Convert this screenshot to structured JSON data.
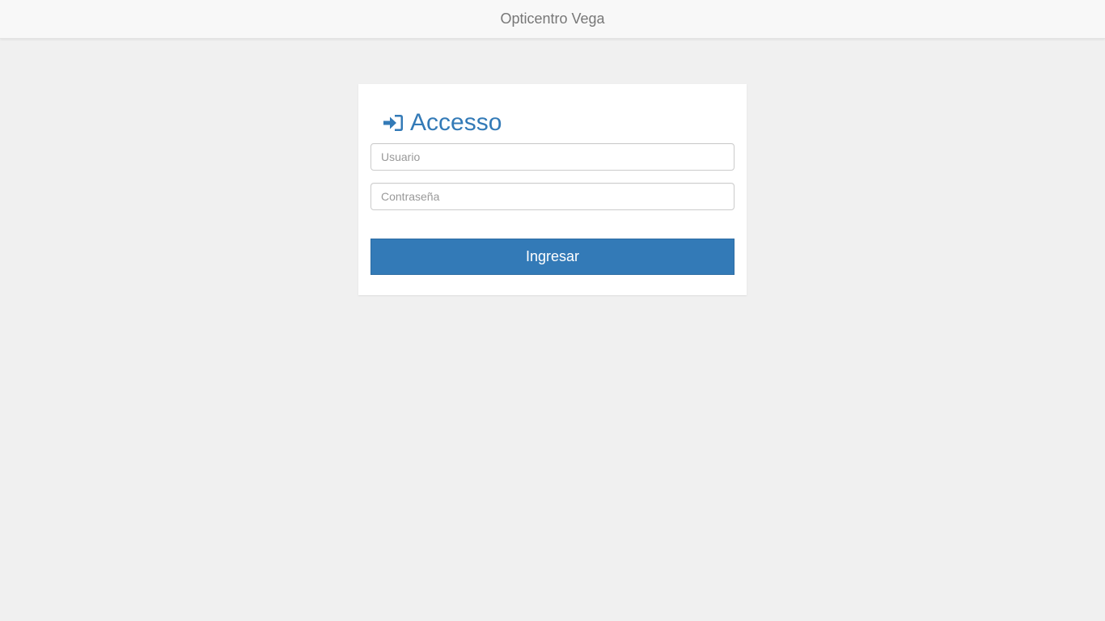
{
  "navbar": {
    "brand": "Opticentro Vega"
  },
  "login": {
    "title": "Accesso",
    "icon": "sign-in-icon",
    "username_placeholder": "Usuario",
    "username_value": "",
    "password_placeholder": "Contraseña",
    "password_value": "",
    "submit_label": "Ingresar"
  },
  "colors": {
    "accent": "#337ab7",
    "background": "#f0f0f0",
    "navbar_bg": "#f8f8f8",
    "card_bg": "#ffffff",
    "brand_text": "#777777"
  }
}
